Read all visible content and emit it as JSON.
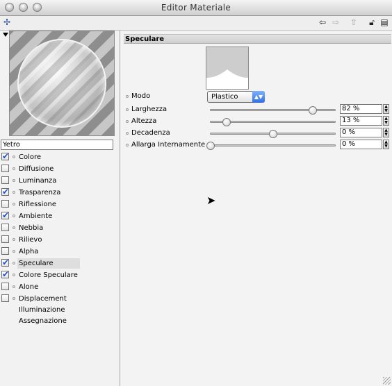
{
  "window": {
    "title": "Editor Materiale"
  },
  "toolbar": {
    "icons": [
      "pin-icon",
      "arrow-left-icon",
      "arrow-right-icon",
      "arrow-up-icon",
      "lock-icon",
      "panel-icon"
    ]
  },
  "material": {
    "name": "Yetro",
    "channels": [
      {
        "label": "Colore",
        "checked": true,
        "selected": false
      },
      {
        "label": "Diffusione",
        "checked": false,
        "selected": false
      },
      {
        "label": "Luminanza",
        "checked": false,
        "selected": false
      },
      {
        "label": "Trasparenza",
        "checked": true,
        "selected": false
      },
      {
        "label": "Riflessione",
        "checked": false,
        "selected": false
      },
      {
        "label": "Ambiente",
        "checked": true,
        "selected": false
      },
      {
        "label": "Nebbia",
        "checked": false,
        "selected": false
      },
      {
        "label": "Rilievo",
        "checked": false,
        "selected": false
      },
      {
        "label": "Alpha",
        "checked": false,
        "selected": false
      },
      {
        "label": "Speculare",
        "checked": true,
        "selected": true
      },
      {
        "label": "Colore Speculare",
        "checked": true,
        "selected": false
      },
      {
        "label": "Alone",
        "checked": false,
        "selected": false
      },
      {
        "label": "Displacement",
        "checked": false,
        "selected": false
      }
    ],
    "extra_items": [
      "Illuminazione",
      "Assegnazione"
    ]
  },
  "specular": {
    "section_title": "Speculare",
    "mode_label": "Modo",
    "mode_value": "Plastico",
    "params": [
      {
        "label": "Larghezza",
        "value": "82 %",
        "level": 0.82
      },
      {
        "label": "Altezza",
        "value": "13 %",
        "level": 0.13
      },
      {
        "label": "Decadenza",
        "value": "0 %",
        "level": 0.5
      },
      {
        "label": "Allarga Internamente",
        "value": "0 %",
        "level": 0.0
      }
    ]
  }
}
